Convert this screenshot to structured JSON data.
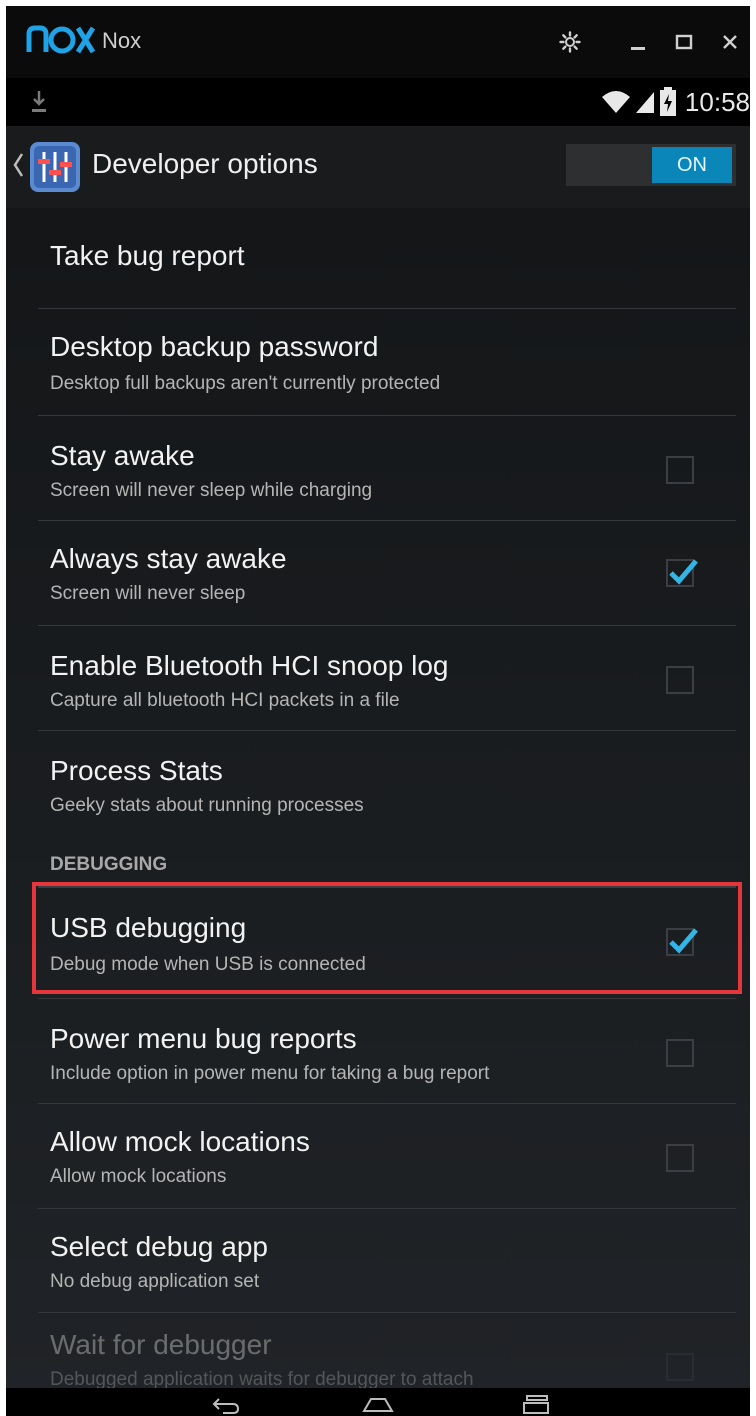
{
  "window": {
    "app_name": "Nox",
    "controls": [
      "settings",
      "minimize",
      "maximize",
      "close"
    ]
  },
  "statusbar": {
    "time": "10:58",
    "icons": [
      "download-icon",
      "wifi-icon",
      "signal-icon",
      "battery-icon"
    ]
  },
  "actionbar": {
    "title": "Developer options",
    "switch_label": "ON"
  },
  "items": [
    {
      "title": "Take bug report",
      "subtitle": "",
      "checkbox": null
    },
    {
      "title": "Desktop backup password",
      "subtitle": "Desktop full backups aren't currently protected",
      "checkbox": null
    },
    {
      "title": "Stay awake",
      "subtitle": "Screen will never sleep while charging",
      "checkbox": false
    },
    {
      "title": "Always stay awake",
      "subtitle": "Screen will never sleep",
      "checkbox": true
    },
    {
      "title": "Enable Bluetooth HCI snoop log",
      "subtitle": "Capture all bluetooth HCI packets in a file",
      "checkbox": false
    },
    {
      "title": "Process Stats",
      "subtitle": "Geeky stats about running processes",
      "checkbox": null
    }
  ],
  "section": {
    "header": "DEBUGGING"
  },
  "debug_items": [
    {
      "title": "USB debugging",
      "subtitle": "Debug mode when USB is connected",
      "checkbox": true
    },
    {
      "title": "Power menu bug reports",
      "subtitle": "Include option in power menu for taking a bug report",
      "checkbox": false
    },
    {
      "title": "Allow mock locations",
      "subtitle": "Allow mock locations",
      "checkbox": false
    },
    {
      "title": "Select debug app",
      "subtitle": "No debug application set",
      "checkbox": null
    },
    {
      "title": "Wait for debugger",
      "subtitle": "Debugged application waits for debugger to attach",
      "checkbox": false
    }
  ],
  "colors": {
    "accent": "#0a87b8",
    "check": "#33b5e5",
    "highlight": "#e5373b",
    "background": "#1b1e21"
  },
  "navbar": {
    "buttons": [
      "back-icon",
      "home-icon",
      "recents-icon"
    ]
  }
}
